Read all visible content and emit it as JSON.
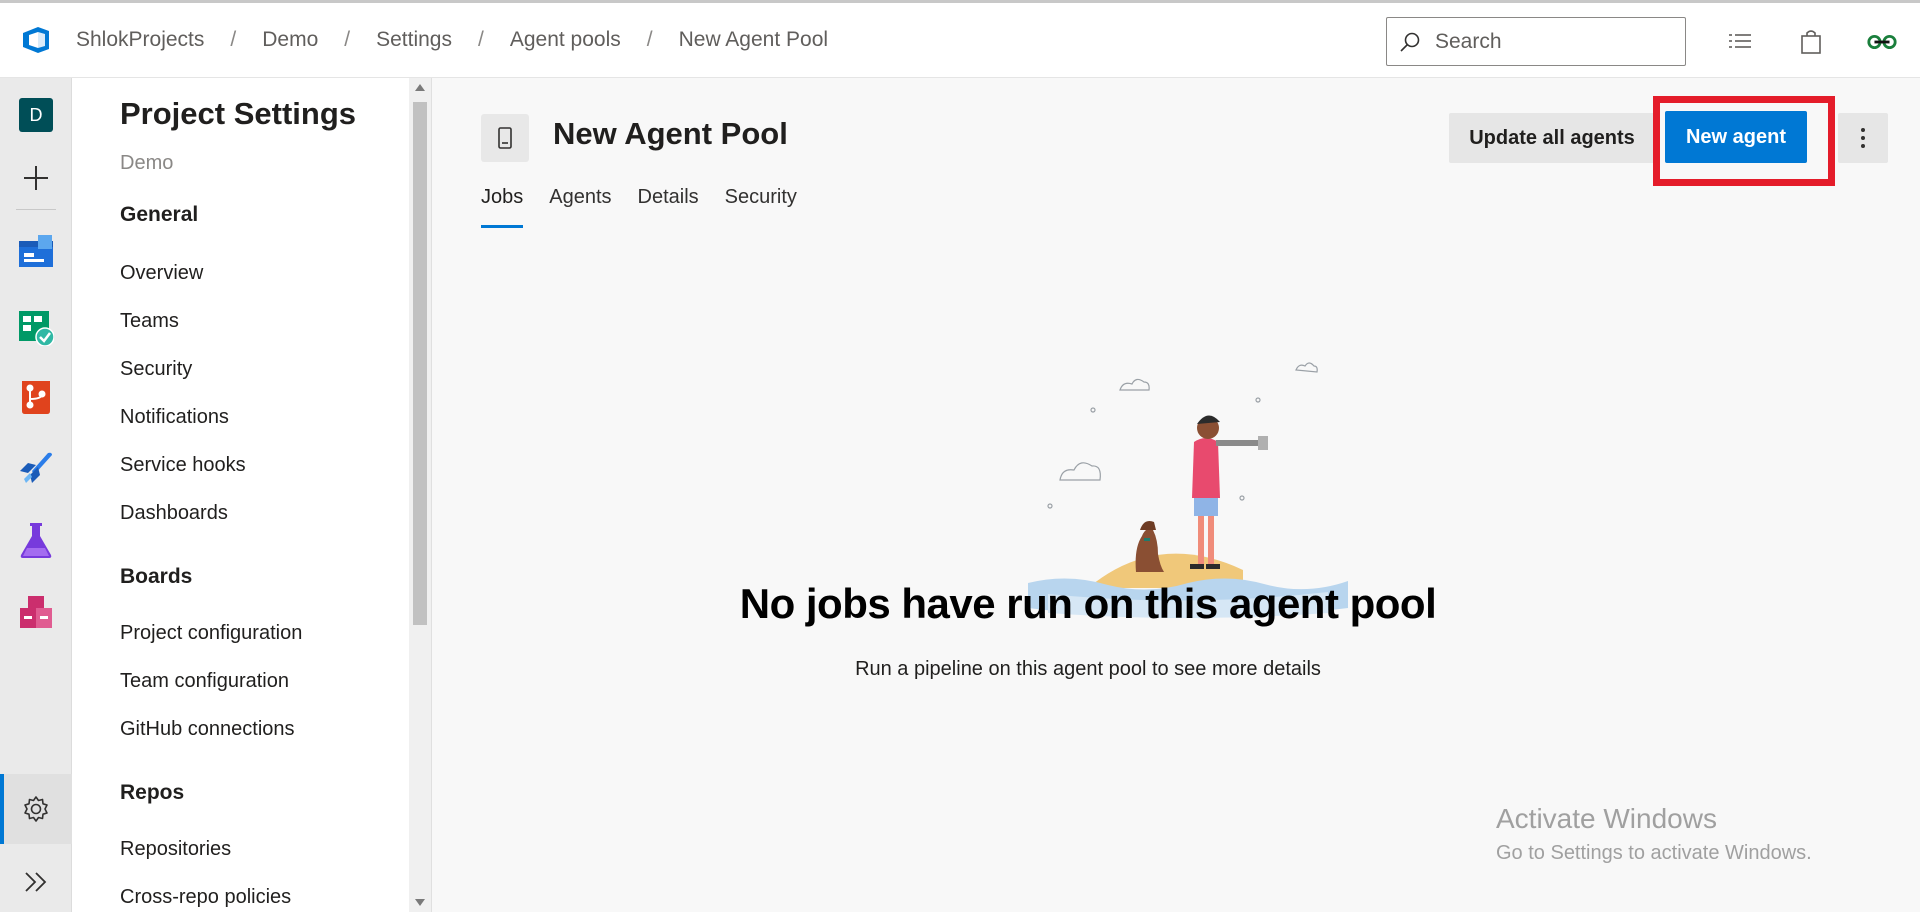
{
  "breadcrumb": [
    "ShlokProjects",
    "Demo",
    "Settings",
    "Agent pools",
    "New Agent Pool"
  ],
  "search": {
    "placeholder": "Search"
  },
  "rail": {
    "avatar_letter": "D",
    "items": [
      "project-avatar",
      "new-icon",
      "overview-icon",
      "boards-icon",
      "repos-icon",
      "pipelines-icon",
      "test-plans-icon",
      "artifacts-icon",
      "settings-icon",
      "expand-icon"
    ]
  },
  "sidebar": {
    "title": "Project Settings",
    "subtitle": "Demo",
    "sections": [
      {
        "label": "General",
        "items": [
          "Overview",
          "Teams",
          "Security",
          "Notifications",
          "Service hooks",
          "Dashboards"
        ]
      },
      {
        "label": "Boards",
        "items": [
          "Project configuration",
          "Team configuration",
          "GitHub connections"
        ]
      },
      {
        "label": "Repos",
        "items": [
          "Repositories",
          "Cross-repo policies"
        ]
      }
    ]
  },
  "main": {
    "title": "New Agent Pool",
    "update_button": "Update all agents",
    "new_agent_button": "New agent",
    "tabs": [
      "Jobs",
      "Agents",
      "Details",
      "Security"
    ],
    "active_tab": "Jobs",
    "empty_title": "No jobs have run on this agent pool",
    "empty_subtitle": "Run a pipeline on this agent pool to see more details"
  },
  "watermark": {
    "line1": "Activate Windows",
    "line2": "Go to Settings to activate Windows."
  },
  "colors": {
    "accent": "#0078d4",
    "highlight": "#e41c2a"
  }
}
